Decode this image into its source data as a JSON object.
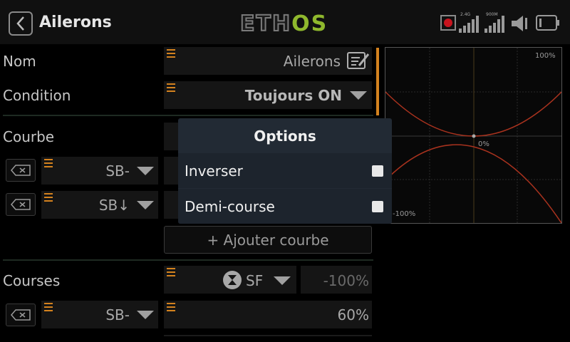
{
  "header": {
    "title": "Ailerons",
    "logo_main": "ETH",
    "logo_accent": "OS",
    "rssi_24": "2.4G",
    "rssi_900": "900M"
  },
  "form": {
    "nom_label": "Nom",
    "nom_value": "Ailerons",
    "condition_label": "Condition",
    "condition_value": "Toujours ON",
    "courbe_label": "Courbe",
    "curve_rows": [
      {
        "source": "SB-"
      },
      {
        "source": "SB↓"
      }
    ],
    "add_curve_label": "+ Ajouter courbe",
    "courses_label": "Courses",
    "courses_source": "SF",
    "courses_value": "-100%",
    "courses_rows": [
      {
        "source": "SB-",
        "value": "60%"
      }
    ]
  },
  "graph": {
    "top_label": "100%",
    "center_label": "0%",
    "bottom_label": "-100%"
  },
  "modal": {
    "title": "Options",
    "options": [
      {
        "label": "Inverser",
        "checked": false
      },
      {
        "label": "Demi-course",
        "checked": false
      }
    ]
  },
  "colors": {
    "accent": "#d4821e",
    "logo_green": "#8fb82d",
    "curve": "#a8321e",
    "modal_bg": "#222a34"
  }
}
